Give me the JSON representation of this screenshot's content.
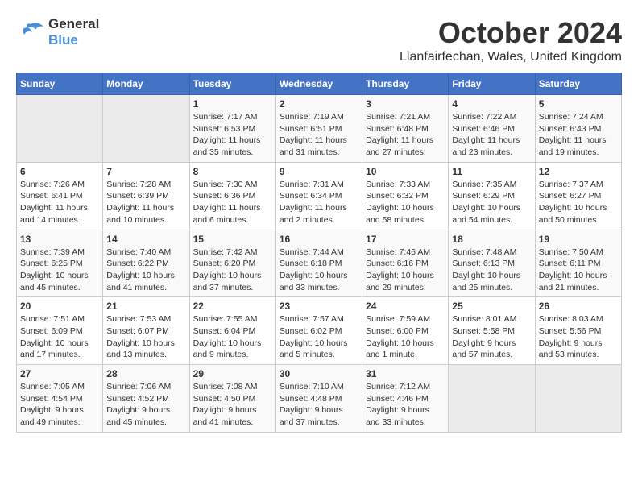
{
  "logo": {
    "line1": "General",
    "line2": "Blue"
  },
  "title": "October 2024",
  "subtitle": "Llanfairfechan, Wales, United Kingdom",
  "days_of_week": [
    "Sunday",
    "Monday",
    "Tuesday",
    "Wednesday",
    "Thursday",
    "Friday",
    "Saturday"
  ],
  "weeks": [
    [
      {
        "day": "",
        "sunrise": "",
        "sunset": "",
        "daylight": "",
        "empty": true
      },
      {
        "day": "",
        "sunrise": "",
        "sunset": "",
        "daylight": "",
        "empty": true
      },
      {
        "day": "1",
        "sunrise": "Sunrise: 7:17 AM",
        "sunset": "Sunset: 6:53 PM",
        "daylight": "Daylight: 11 hours and 35 minutes."
      },
      {
        "day": "2",
        "sunrise": "Sunrise: 7:19 AM",
        "sunset": "Sunset: 6:51 PM",
        "daylight": "Daylight: 11 hours and 31 minutes."
      },
      {
        "day": "3",
        "sunrise": "Sunrise: 7:21 AM",
        "sunset": "Sunset: 6:48 PM",
        "daylight": "Daylight: 11 hours and 27 minutes."
      },
      {
        "day": "4",
        "sunrise": "Sunrise: 7:22 AM",
        "sunset": "Sunset: 6:46 PM",
        "daylight": "Daylight: 11 hours and 23 minutes."
      },
      {
        "day": "5",
        "sunrise": "Sunrise: 7:24 AM",
        "sunset": "Sunset: 6:43 PM",
        "daylight": "Daylight: 11 hours and 19 minutes."
      }
    ],
    [
      {
        "day": "6",
        "sunrise": "Sunrise: 7:26 AM",
        "sunset": "Sunset: 6:41 PM",
        "daylight": "Daylight: 11 hours and 14 minutes."
      },
      {
        "day": "7",
        "sunrise": "Sunrise: 7:28 AM",
        "sunset": "Sunset: 6:39 PM",
        "daylight": "Daylight: 11 hours and 10 minutes."
      },
      {
        "day": "8",
        "sunrise": "Sunrise: 7:30 AM",
        "sunset": "Sunset: 6:36 PM",
        "daylight": "Daylight: 11 hours and 6 minutes."
      },
      {
        "day": "9",
        "sunrise": "Sunrise: 7:31 AM",
        "sunset": "Sunset: 6:34 PM",
        "daylight": "Daylight: 11 hours and 2 minutes."
      },
      {
        "day": "10",
        "sunrise": "Sunrise: 7:33 AM",
        "sunset": "Sunset: 6:32 PM",
        "daylight": "Daylight: 10 hours and 58 minutes."
      },
      {
        "day": "11",
        "sunrise": "Sunrise: 7:35 AM",
        "sunset": "Sunset: 6:29 PM",
        "daylight": "Daylight: 10 hours and 54 minutes."
      },
      {
        "day": "12",
        "sunrise": "Sunrise: 7:37 AM",
        "sunset": "Sunset: 6:27 PM",
        "daylight": "Daylight: 10 hours and 50 minutes."
      }
    ],
    [
      {
        "day": "13",
        "sunrise": "Sunrise: 7:39 AM",
        "sunset": "Sunset: 6:25 PM",
        "daylight": "Daylight: 10 hours and 45 minutes."
      },
      {
        "day": "14",
        "sunrise": "Sunrise: 7:40 AM",
        "sunset": "Sunset: 6:22 PM",
        "daylight": "Daylight: 10 hours and 41 minutes."
      },
      {
        "day": "15",
        "sunrise": "Sunrise: 7:42 AM",
        "sunset": "Sunset: 6:20 PM",
        "daylight": "Daylight: 10 hours and 37 minutes."
      },
      {
        "day": "16",
        "sunrise": "Sunrise: 7:44 AM",
        "sunset": "Sunset: 6:18 PM",
        "daylight": "Daylight: 10 hours and 33 minutes."
      },
      {
        "day": "17",
        "sunrise": "Sunrise: 7:46 AM",
        "sunset": "Sunset: 6:16 PM",
        "daylight": "Daylight: 10 hours and 29 minutes."
      },
      {
        "day": "18",
        "sunrise": "Sunrise: 7:48 AM",
        "sunset": "Sunset: 6:13 PM",
        "daylight": "Daylight: 10 hours and 25 minutes."
      },
      {
        "day": "19",
        "sunrise": "Sunrise: 7:50 AM",
        "sunset": "Sunset: 6:11 PM",
        "daylight": "Daylight: 10 hours and 21 minutes."
      }
    ],
    [
      {
        "day": "20",
        "sunrise": "Sunrise: 7:51 AM",
        "sunset": "Sunset: 6:09 PM",
        "daylight": "Daylight: 10 hours and 17 minutes."
      },
      {
        "day": "21",
        "sunrise": "Sunrise: 7:53 AM",
        "sunset": "Sunset: 6:07 PM",
        "daylight": "Daylight: 10 hours and 13 minutes."
      },
      {
        "day": "22",
        "sunrise": "Sunrise: 7:55 AM",
        "sunset": "Sunset: 6:04 PM",
        "daylight": "Daylight: 10 hours and 9 minutes."
      },
      {
        "day": "23",
        "sunrise": "Sunrise: 7:57 AM",
        "sunset": "Sunset: 6:02 PM",
        "daylight": "Daylight: 10 hours and 5 minutes."
      },
      {
        "day": "24",
        "sunrise": "Sunrise: 7:59 AM",
        "sunset": "Sunset: 6:00 PM",
        "daylight": "Daylight: 10 hours and 1 minute."
      },
      {
        "day": "25",
        "sunrise": "Sunrise: 8:01 AM",
        "sunset": "Sunset: 5:58 PM",
        "daylight": "Daylight: 9 hours and 57 minutes."
      },
      {
        "day": "26",
        "sunrise": "Sunrise: 8:03 AM",
        "sunset": "Sunset: 5:56 PM",
        "daylight": "Daylight: 9 hours and 53 minutes."
      }
    ],
    [
      {
        "day": "27",
        "sunrise": "Sunrise: 7:05 AM",
        "sunset": "Sunset: 4:54 PM",
        "daylight": "Daylight: 9 hours and 49 minutes."
      },
      {
        "day": "28",
        "sunrise": "Sunrise: 7:06 AM",
        "sunset": "Sunset: 4:52 PM",
        "daylight": "Daylight: 9 hours and 45 minutes."
      },
      {
        "day": "29",
        "sunrise": "Sunrise: 7:08 AM",
        "sunset": "Sunset: 4:50 PM",
        "daylight": "Daylight: 9 hours and 41 minutes."
      },
      {
        "day": "30",
        "sunrise": "Sunrise: 7:10 AM",
        "sunset": "Sunset: 4:48 PM",
        "daylight": "Daylight: 9 hours and 37 minutes."
      },
      {
        "day": "31",
        "sunrise": "Sunrise: 7:12 AM",
        "sunset": "Sunset: 4:46 PM",
        "daylight": "Daylight: 9 hours and 33 minutes."
      },
      {
        "day": "",
        "sunrise": "",
        "sunset": "",
        "daylight": "",
        "empty": true
      },
      {
        "day": "",
        "sunrise": "",
        "sunset": "",
        "daylight": "",
        "empty": true
      }
    ]
  ]
}
